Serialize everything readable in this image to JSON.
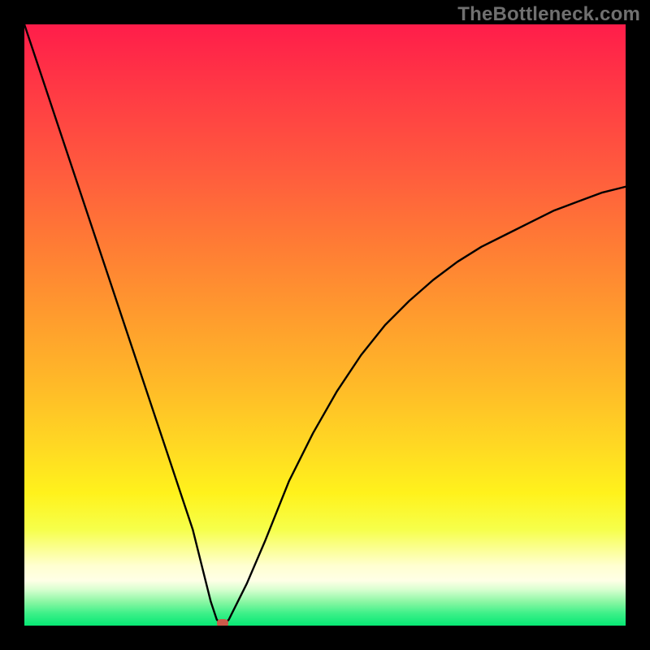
{
  "watermark": "TheBottleneck.com",
  "colors": {
    "frame_bg": "#000000",
    "curve_stroke": "#000000",
    "marker_fill": "#cc5a4a",
    "watermark_text": "#707070"
  },
  "chart_data": {
    "type": "line",
    "title": "",
    "xlabel": "",
    "ylabel": "",
    "xlim": [
      0,
      100
    ],
    "ylim": [
      0,
      100
    ],
    "grid": false,
    "legend": false,
    "series": [
      {
        "name": "bottleneck-curve",
        "x": [
          0,
          2,
          4,
          6,
          8,
          10,
          12,
          14,
          16,
          18,
          20,
          22,
          24,
          26,
          28,
          30,
          31,
          32,
          33,
          34,
          35,
          37,
          40,
          44,
          48,
          52,
          56,
          60,
          64,
          68,
          72,
          76,
          80,
          84,
          88,
          92,
          96,
          100
        ],
        "y": [
          100,
          94,
          88,
          82,
          76,
          70,
          64,
          58,
          52,
          46,
          40,
          34,
          28,
          22,
          16,
          8,
          4,
          1,
          0,
          1,
          3,
          7,
          14,
          24,
          32,
          39,
          45,
          50,
          54,
          57.5,
          60.5,
          63,
          65,
          67,
          69,
          70.5,
          72,
          73
        ]
      }
    ],
    "annotations": [
      {
        "name": "minimum-marker",
        "x": 33,
        "y": 0
      }
    ],
    "gradient_stops": [
      {
        "pos": 0.0,
        "color": "#ff1d4a"
      },
      {
        "pos": 0.5,
        "color": "#ffba28"
      },
      {
        "pos": 0.8,
        "color": "#fff21c"
      },
      {
        "pos": 0.93,
        "color": "#ffffe0"
      },
      {
        "pos": 1.0,
        "color": "#06e874"
      }
    ]
  }
}
